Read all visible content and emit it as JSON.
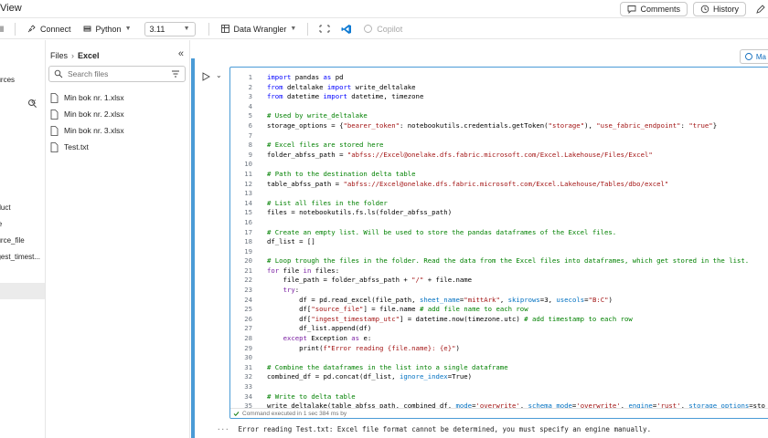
{
  "header": {
    "view_label": "View",
    "comments_label": "Comments",
    "history_label": "History"
  },
  "toolbar": {
    "all_label": "ll",
    "connect_label": "Connect",
    "language_label": "Python",
    "version_value": "3.11",
    "data_wrangler_label": "Data Wrangler",
    "copilot_label": "Copilot"
  },
  "leftnav": {
    "items": [
      "ources",
      "oduct",
      "ice",
      "ource_file",
      "ngest_timest..."
    ]
  },
  "files": {
    "breadcrumb_root": "Files",
    "breadcrumb_current": "Excel",
    "search_placeholder": "Search files",
    "items": [
      "Min bok nr. 1.xlsx",
      "Min bok nr. 2.xlsx",
      "Min bok nr. 3.xlsx",
      "Test.txt"
    ]
  },
  "cell": {
    "ma_label": "Ma",
    "status_text": "Command executed in 1 sec 384 ms by",
    "output_dots": "···",
    "output_text": "Error reading Test.txt: Excel file format cannot be determined, you must specify an engine manually.",
    "lines": [
      {
        "n": "1",
        "tokens": [
          {
            "t": "import",
            "c": "kw"
          },
          {
            "t": " pandas "
          },
          {
            "t": "as",
            "c": "kw"
          },
          {
            "t": " pd"
          }
        ]
      },
      {
        "n": "2",
        "tokens": [
          {
            "t": "from",
            "c": "kw"
          },
          {
            "t": " deltalake "
          },
          {
            "t": "import",
            "c": "kw"
          },
          {
            "t": " write_deltalake"
          }
        ]
      },
      {
        "n": "3",
        "tokens": [
          {
            "t": "from",
            "c": "kw"
          },
          {
            "t": " datetime "
          },
          {
            "t": "import",
            "c": "kw"
          },
          {
            "t": " datetime, timezone"
          }
        ]
      },
      {
        "n": "4",
        "tokens": []
      },
      {
        "n": "5",
        "tokens": [
          {
            "t": "# Used by write_deltalake",
            "c": "cm"
          }
        ]
      },
      {
        "n": "6",
        "tokens": [
          {
            "t": "storage_options = {"
          },
          {
            "t": "\"bearer_token\"",
            "c": "str"
          },
          {
            "t": ": notebookutils.credentials.getToken("
          },
          {
            "t": "\"storage\"",
            "c": "str"
          },
          {
            "t": "), "
          },
          {
            "t": "\"use_fabric_endpoint\"",
            "c": "str"
          },
          {
            "t": ": "
          },
          {
            "t": "\"true\"",
            "c": "str"
          },
          {
            "t": "}"
          }
        ]
      },
      {
        "n": "7",
        "tokens": []
      },
      {
        "n": "8",
        "tokens": [
          {
            "t": "# Excel files are stored here",
            "c": "cm"
          }
        ]
      },
      {
        "n": "9",
        "tokens": [
          {
            "t": "folder_abfss_path = "
          },
          {
            "t": "\"abfss://Excel@onelake.dfs.fabric.microsoft.com/Excel.Lakehouse/Files/Excel\"",
            "c": "str"
          }
        ]
      },
      {
        "n": "10",
        "tokens": []
      },
      {
        "n": "11",
        "tokens": [
          {
            "t": "# Path to the destination delta table",
            "c": "cm"
          }
        ]
      },
      {
        "n": "12",
        "tokens": [
          {
            "t": "table_abfss_path = "
          },
          {
            "t": "\"abfss://Excel@onelake.dfs.fabric.microsoft.com/Excel.Lakehouse/Tables/dbo/excel\"",
            "c": "str"
          }
        ]
      },
      {
        "n": "13",
        "tokens": []
      },
      {
        "n": "14",
        "tokens": [
          {
            "t": "# List all files in the folder",
            "c": "cm"
          }
        ]
      },
      {
        "n": "15",
        "tokens": [
          {
            "t": "files = notebookutils.fs.ls(folder_abfss_path)"
          }
        ]
      },
      {
        "n": "16",
        "tokens": []
      },
      {
        "n": "17",
        "tokens": [
          {
            "t": "# Create an empty list. Will be used to store the pandas dataframes of the Excel files.",
            "c": "cm"
          }
        ]
      },
      {
        "n": "18",
        "tokens": [
          {
            "t": "df_list = []"
          }
        ]
      },
      {
        "n": "19",
        "tokens": []
      },
      {
        "n": "20",
        "tokens": [
          {
            "t": "# Loop trough the files in the folder. Read the data from the Excel files into dataframes, which get stored in the list.",
            "c": "cm"
          }
        ]
      },
      {
        "n": "21",
        "tokens": [
          {
            "t": "for",
            "c": "kw2"
          },
          {
            "t": " file "
          },
          {
            "t": "in",
            "c": "kw2"
          },
          {
            "t": " files:"
          }
        ]
      },
      {
        "n": "22",
        "tokens": [
          {
            "t": "    file_path = folder_abfss_path + "
          },
          {
            "t": "\"/\"",
            "c": "str"
          },
          {
            "t": " + file.name"
          }
        ]
      },
      {
        "n": "23",
        "tokens": [
          {
            "t": "    "
          },
          {
            "t": "try",
            "c": "kw2"
          },
          {
            "t": ":"
          }
        ]
      },
      {
        "n": "24",
        "tokens": [
          {
            "t": "        df = pd.read_excel(file_path, "
          },
          {
            "t": "sheet_name",
            "c": "prm"
          },
          {
            "t": "="
          },
          {
            "t": "\"mittArk\"",
            "c": "str"
          },
          {
            "t": ", "
          },
          {
            "t": "skiprows",
            "c": "prm"
          },
          {
            "t": "=3, "
          },
          {
            "t": "usecols",
            "c": "prm"
          },
          {
            "t": "="
          },
          {
            "t": "\"B:C\"",
            "c": "str"
          },
          {
            "t": ")"
          }
        ]
      },
      {
        "n": "25",
        "tokens": [
          {
            "t": "        df["
          },
          {
            "t": "\"source_file\"",
            "c": "str"
          },
          {
            "t": "] = file.name "
          },
          {
            "t": "# add file name to each row",
            "c": "cm"
          }
        ]
      },
      {
        "n": "26",
        "tokens": [
          {
            "t": "        df["
          },
          {
            "t": "\"ingest_timestamp_utc\"",
            "c": "str"
          },
          {
            "t": "] = datetime.now(timezone.utc) "
          },
          {
            "t": "# add timestamp to each row",
            "c": "cm"
          }
        ]
      },
      {
        "n": "27",
        "tokens": [
          {
            "t": "        df_list.append(df)"
          }
        ]
      },
      {
        "n": "28",
        "tokens": [
          {
            "t": "    "
          },
          {
            "t": "except",
            "c": "kw2"
          },
          {
            "t": " Exception "
          },
          {
            "t": "as",
            "c": "kw2"
          },
          {
            "t": " e:"
          }
        ]
      },
      {
        "n": "29",
        "tokens": [
          {
            "t": "        print("
          },
          {
            "t": "f\"Error reading {file.name}: {e}\"",
            "c": "str"
          },
          {
            "t": ")"
          }
        ]
      },
      {
        "n": "30",
        "tokens": []
      },
      {
        "n": "31",
        "tokens": [
          {
            "t": "# Combine the dataframes in the list into a single dataframe",
            "c": "cm"
          }
        ]
      },
      {
        "n": "32",
        "tokens": [
          {
            "t": "combined_df = pd.concat(df_list, "
          },
          {
            "t": "ignore_index",
            "c": "prm"
          },
          {
            "t": "=True)"
          }
        ]
      },
      {
        "n": "33",
        "tokens": []
      },
      {
        "n": "34",
        "tokens": [
          {
            "t": "# Write to delta table",
            "c": "cm"
          }
        ]
      },
      {
        "n": "35",
        "tokens": [
          {
            "t": "write_deltalake(table_abfss_path, combined_df, "
          },
          {
            "t": "mode",
            "c": "prm"
          },
          {
            "t": "="
          },
          {
            "t": "'overwrite'",
            "c": "str"
          },
          {
            "t": ", "
          },
          {
            "t": "schema_mode",
            "c": "prm"
          },
          {
            "t": "="
          },
          {
            "t": "'overwrite'",
            "c": "str"
          },
          {
            "t": ", "
          },
          {
            "t": "engine",
            "c": "prm"
          },
          {
            "t": "="
          },
          {
            "t": "'rust'",
            "c": "str"
          },
          {
            "t": ", "
          },
          {
            "t": "storage_options",
            "c": "prm"
          },
          {
            "t": "=sto"
          }
        ]
      }
    ]
  },
  "colors": {
    "accent": "#4a9bd6",
    "keyword": "#0000ff",
    "string": "#a31515",
    "comment": "#008000"
  }
}
